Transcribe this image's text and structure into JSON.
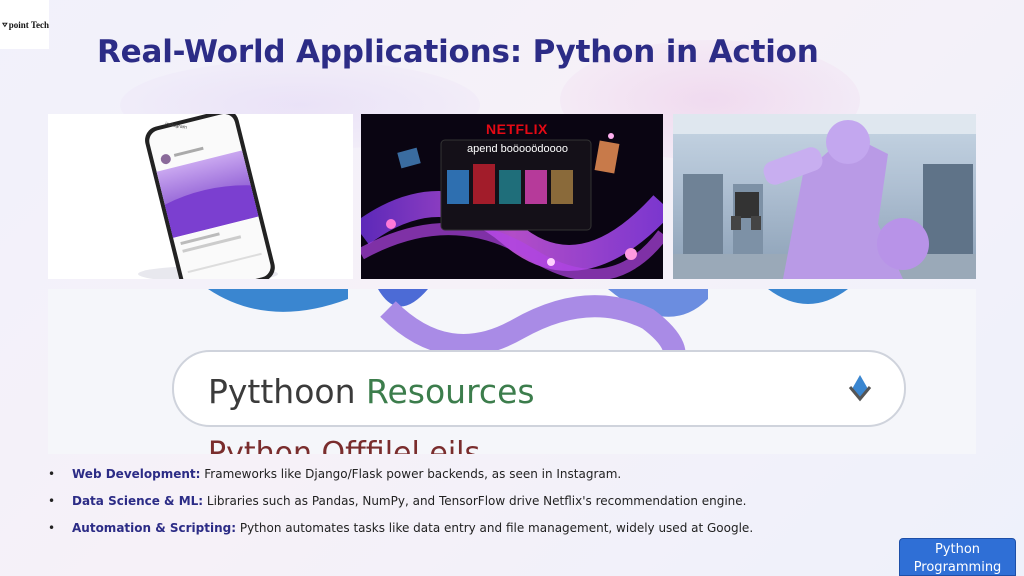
{
  "logo": {
    "text": "point Tech"
  },
  "slide": {
    "title": "Real-World Applications: Python in Action"
  },
  "images": {
    "instagram": {
      "app_label": "instagram"
    },
    "netflix": {
      "logo": "NETFLIX",
      "heading": "apend boöooödoooo"
    },
    "robot": {},
    "google": {
      "search_word_1": "Pytthoon",
      "search_word_2": "Resources",
      "sub_text": "Python Offfilel eils"
    }
  },
  "bullets": [
    {
      "label": "Web Development:",
      "text": " Frameworks like Django/Flask power backends, as seen in Instagram."
    },
    {
      "label": "Data Science & ML:",
      "text": " Libraries such as Pandas, NumPy, and TensorFlow drive Netflix's recommendation engine."
    },
    {
      "label": "Automation & Scripting:",
      "text": " Python automates tasks like data entry and file management, widely used at Google."
    }
  ],
  "footer": {
    "badge": "Python Programming"
  },
  "colors": {
    "title": "#2c2c86",
    "accent_blue": "#2f6fd6",
    "purple": "#a98be6"
  }
}
